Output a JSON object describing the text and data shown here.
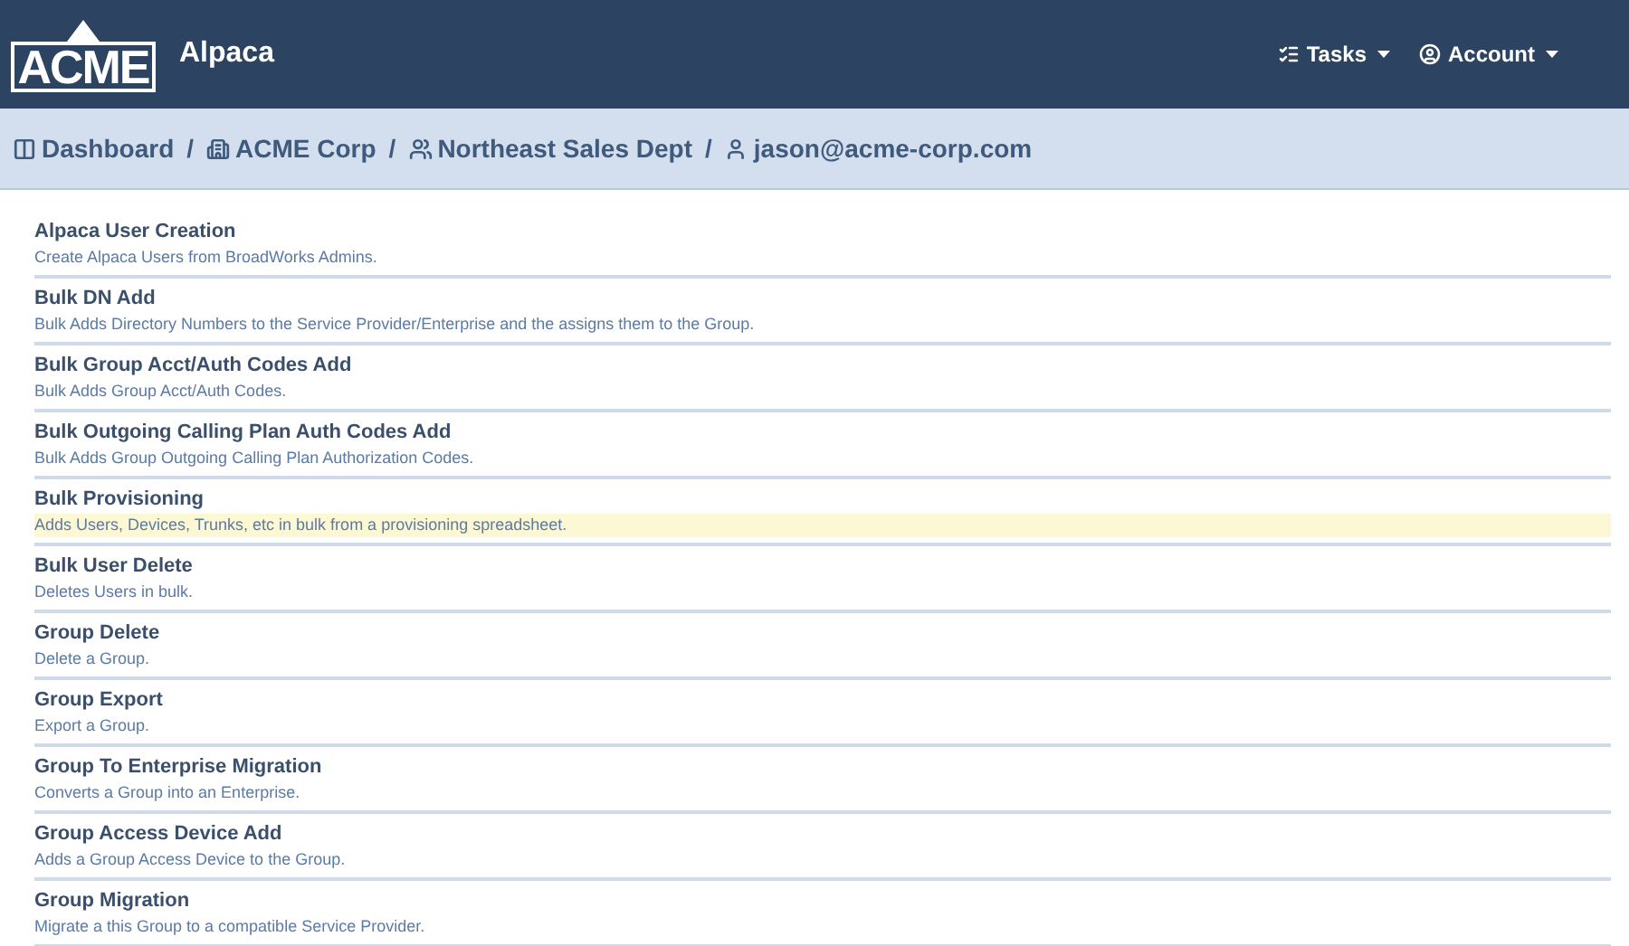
{
  "header": {
    "logo": "ACME",
    "app_name": "Alpaca",
    "menus": [
      {
        "label": "Tasks",
        "kind": "tasks"
      },
      {
        "label": "Account",
        "kind": "account"
      }
    ]
  },
  "breadcrumb": [
    {
      "label": "Dashboard",
      "kind": "dashboard"
    },
    {
      "separator": "/",
      "label": "ACME Corp",
      "kind": "enterprise"
    },
    {
      "separator": "/",
      "label": "Northeast Sales Dept",
      "kind": "group"
    },
    {
      "separator": "/",
      "label": "jason@acme-corp.com",
      "kind": "user"
    }
  ],
  "tasks": [
    {
      "title": "Alpaca User Creation",
      "description": "Create Alpaca Users from BroadWorks Admins.",
      "highlighted": false
    },
    {
      "title": "Bulk DN Add",
      "description": "Bulk Adds Directory Numbers to the Service Provider/Enterprise and the assigns them to the Group.",
      "highlighted": false
    },
    {
      "title": "Bulk Group Acct/Auth Codes Add",
      "description": "Bulk Adds Group Acct/Auth Codes.",
      "highlighted": false
    },
    {
      "title": "Bulk Outgoing Calling Plan Auth Codes Add",
      "description": "Bulk Adds Group Outgoing Calling Plan Authorization Codes.",
      "highlighted": false
    },
    {
      "title": "Bulk Provisioning",
      "description": "Adds Users, Devices, Trunks, etc in bulk from a provisioning spreadsheet.",
      "highlighted": true
    },
    {
      "title": "Bulk User Delete",
      "description": "Deletes Users in bulk.",
      "highlighted": false
    },
    {
      "title": "Group Delete",
      "description": "Delete a Group.",
      "highlighted": false
    },
    {
      "title": "Group Export",
      "description": "Export a Group.",
      "highlighted": false
    },
    {
      "title": "Group To Enterprise Migration",
      "description": "Converts a Group into an Enterprise.",
      "highlighted": false
    },
    {
      "title": "Group Access Device Add",
      "description": "Adds a Group Access Device to the Group.",
      "highlighted": false
    },
    {
      "title": "Group Migration",
      "description": "Migrate a this Group to a compatible Service Provider.",
      "highlighted": false
    }
  ]
}
